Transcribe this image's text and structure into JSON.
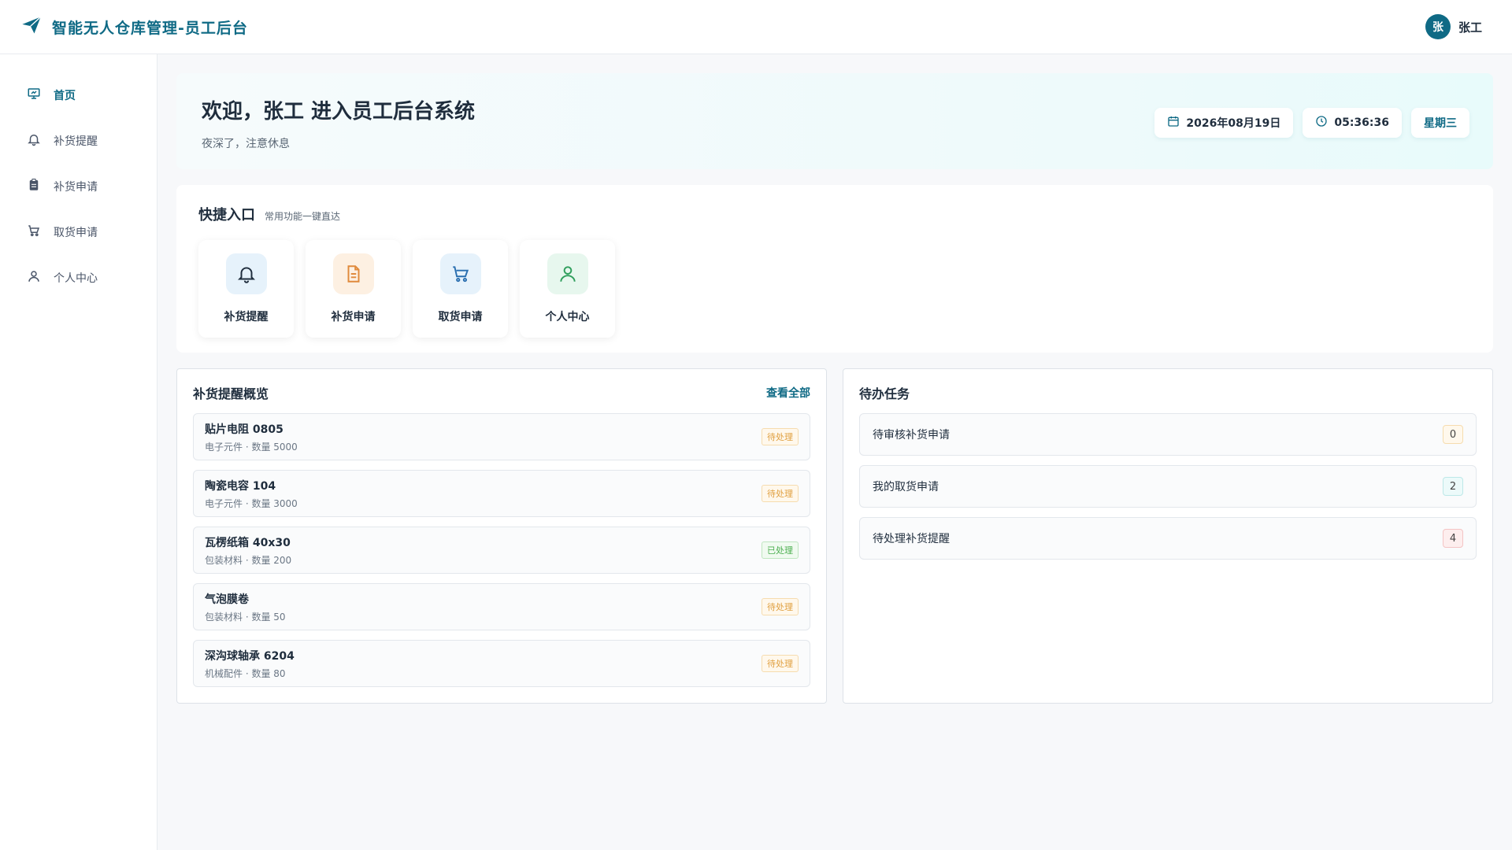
{
  "header": {
    "title": "智能无人仓库管理-员工后台",
    "avatar_letter": "张",
    "user_name": "张工"
  },
  "sidebar": {
    "items": [
      {
        "label": "首页",
        "icon": "presentation-icon",
        "active": true
      },
      {
        "label": "补货提醒",
        "icon": "bell-icon"
      },
      {
        "label": "补货申请",
        "icon": "clipboard-icon"
      },
      {
        "label": "取货申请",
        "icon": "cart-icon"
      },
      {
        "label": "个人中心",
        "icon": "user-icon"
      }
    ]
  },
  "welcome": {
    "title": "欢迎，张工 进入员工后台系统",
    "subtitle": "夜深了，注意休息",
    "date": "2026年08月19日",
    "time": "05:36:36",
    "weekday": "星期三"
  },
  "quick": {
    "title": "快捷入口",
    "subtitle": "常用功能一键直达",
    "cards": [
      {
        "label": "补货提醒",
        "icon": "bell-icon",
        "bg": "#e6f2fb",
        "color": "#1f2d3d"
      },
      {
        "label": "补货申请",
        "icon": "document-icon",
        "bg": "#fdf0e2",
        "color": "#e08a3c"
      },
      {
        "label": "取货申请",
        "icon": "cart-icon",
        "bg": "#e6f2fb",
        "color": "#2a6fb0"
      },
      {
        "label": "个人中心",
        "icon": "user-icon",
        "bg": "#e7f7ee",
        "color": "#2f9e5c"
      }
    ]
  },
  "reminders": {
    "title": "补货提醒概览",
    "view_all": "查看全部",
    "items": [
      {
        "name": "贴片电阻 0805",
        "meta": "电子元件 · 数量 5000",
        "status": "待处理",
        "done": false
      },
      {
        "name": "陶瓷电容 104",
        "meta": "电子元件 · 数量 3000",
        "status": "待处理",
        "done": false
      },
      {
        "name": "瓦楞纸箱 40x30",
        "meta": "包装材料 · 数量 200",
        "status": "已处理",
        "done": true
      },
      {
        "name": "气泡膜卷",
        "meta": "包装材料 · 数量 50",
        "status": "待处理",
        "done": false
      },
      {
        "name": "深沟球轴承 6204",
        "meta": "机械配件 · 数量 80",
        "status": "待处理",
        "done": false
      }
    ]
  },
  "tasks": {
    "title": "待办任务",
    "items": [
      {
        "label": "待审核补货申请",
        "count": "0"
      },
      {
        "label": "我的取货申请",
        "count": "2"
      },
      {
        "label": "待处理补货提醒",
        "count": "4"
      }
    ]
  }
}
